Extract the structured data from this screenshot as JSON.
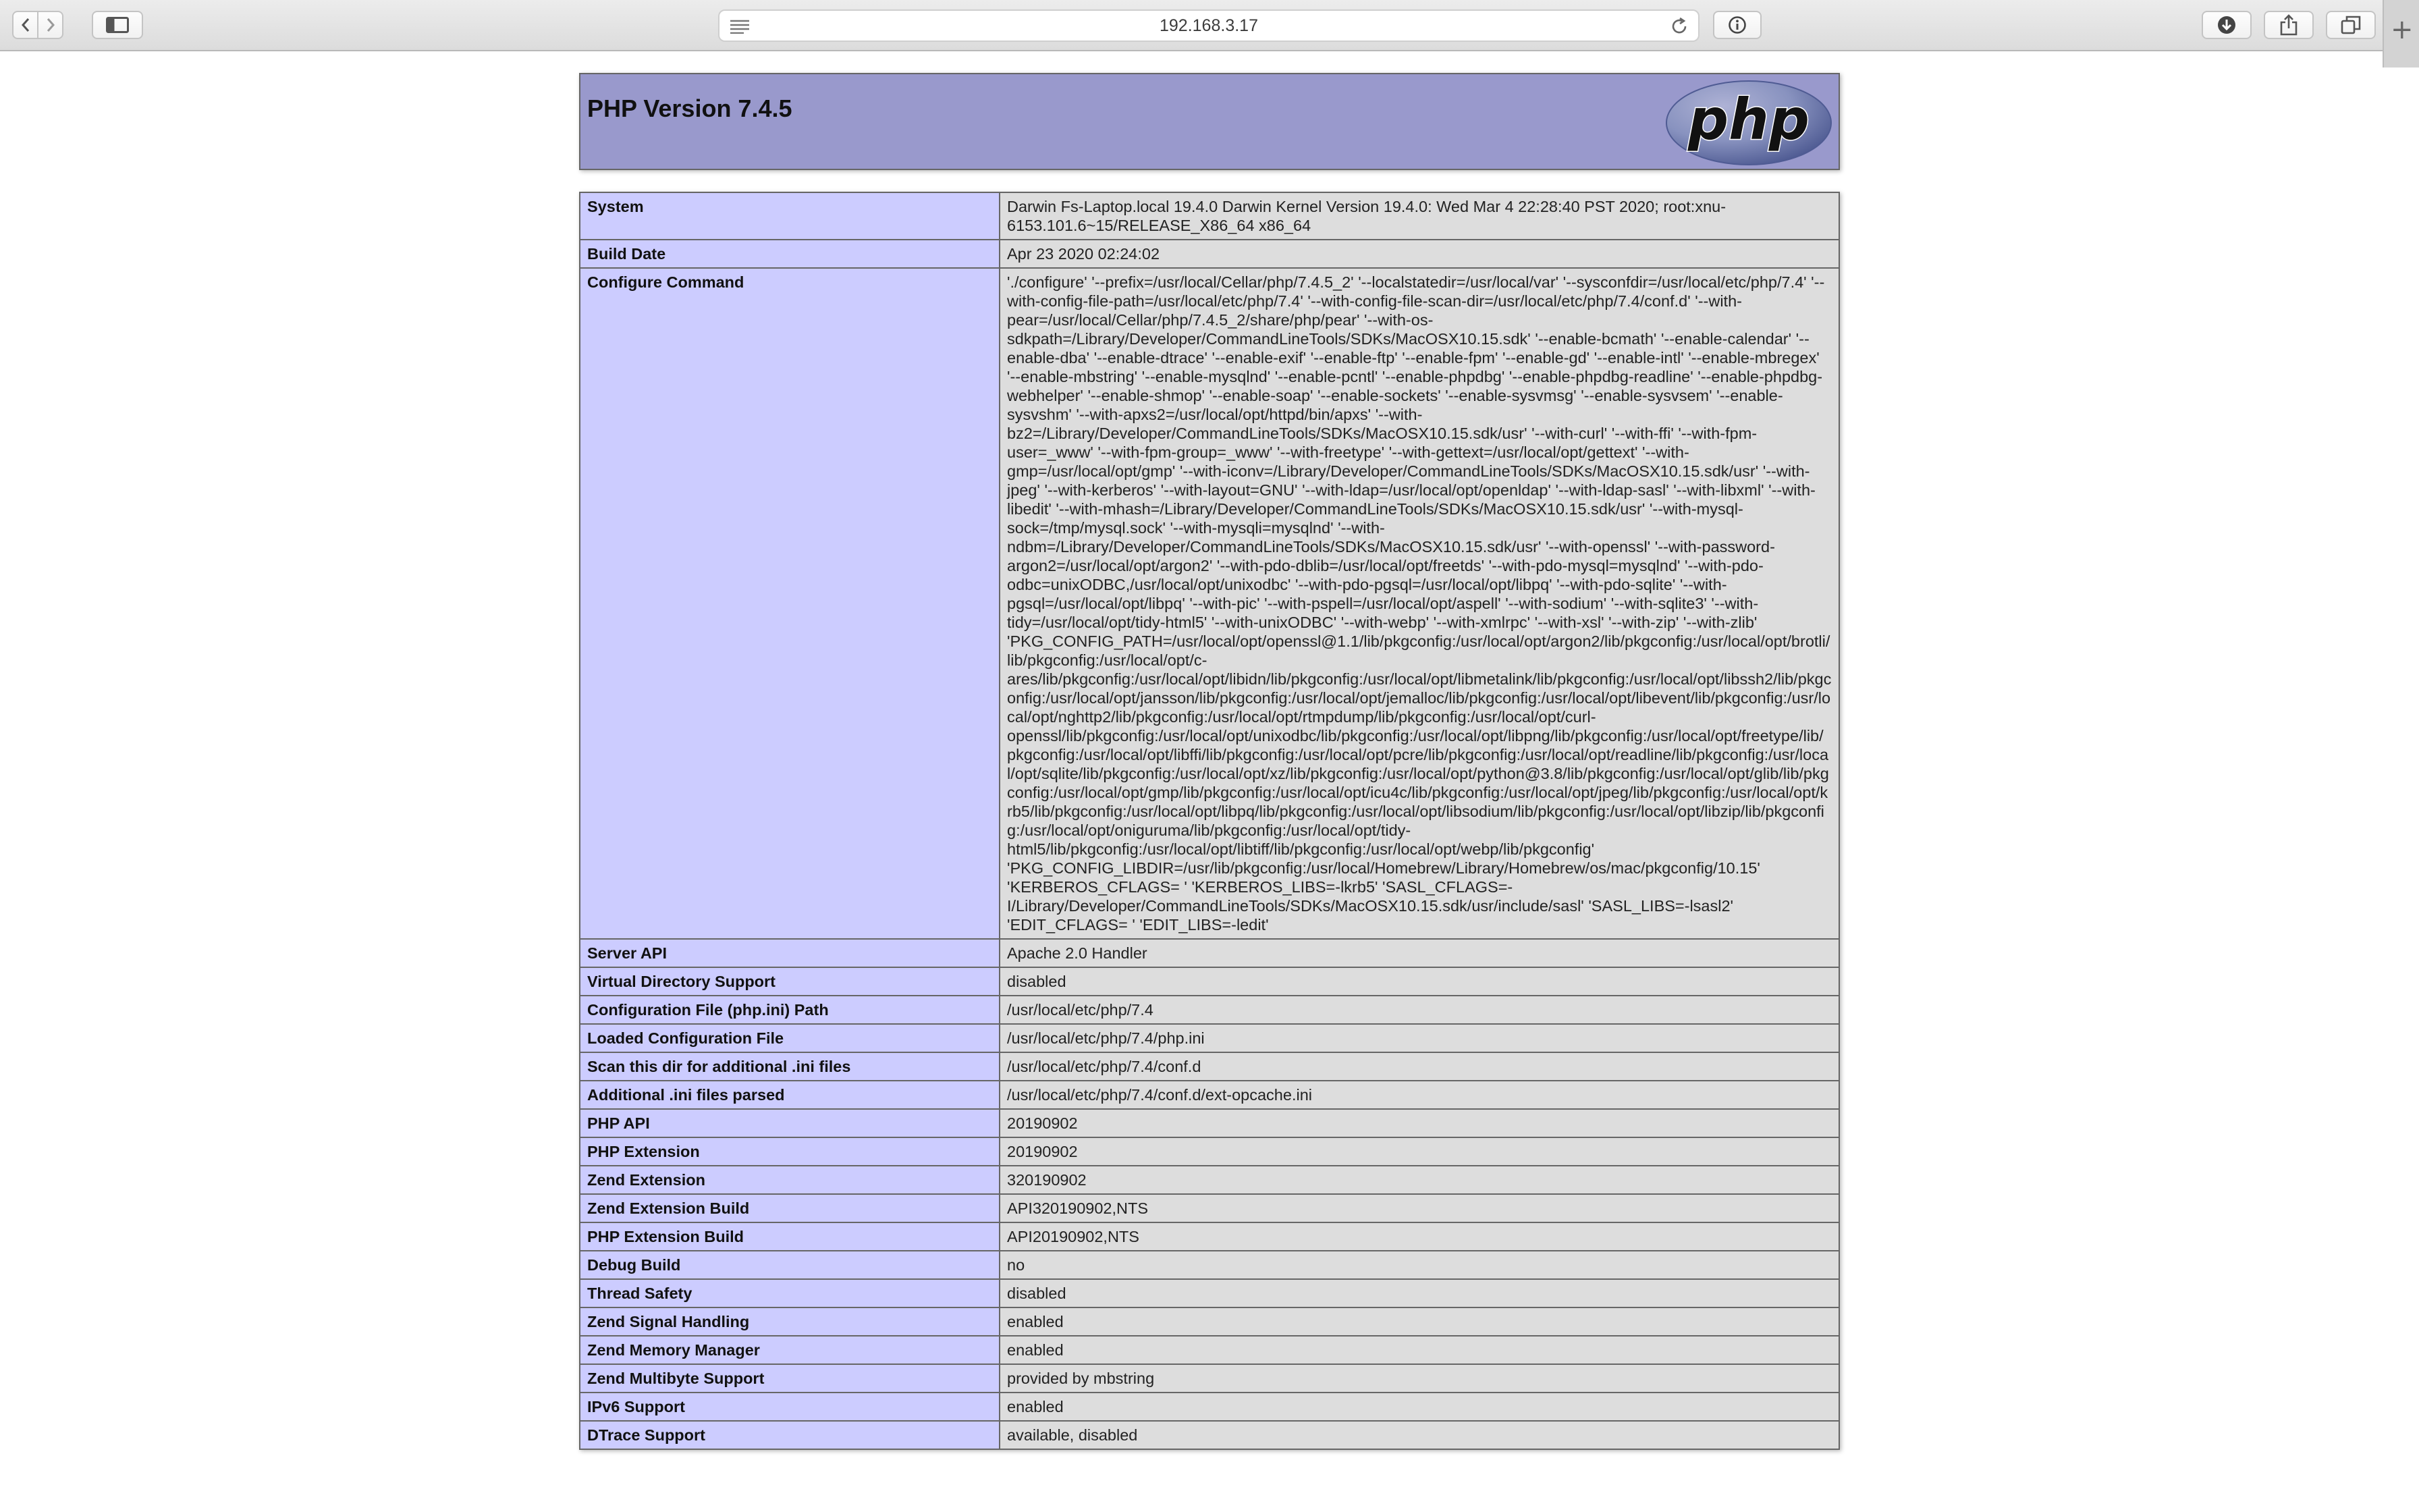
{
  "browser": {
    "url": "192.168.3.17",
    "new_tab_symbol": "+"
  },
  "icons": {
    "back": "chevron-left-icon",
    "forward": "chevron-right-icon",
    "sidebar": "sidebar-icon",
    "reader": "reader-icon",
    "reload": "reload-icon",
    "info": "info-icon",
    "downloads": "download-icon",
    "share": "share-icon",
    "tabs": "tab-overview-icon"
  },
  "colors": {
    "header_bg": "#9999cc",
    "key_cell_bg": "#ccccff",
    "value_cell_bg": "#dddddd",
    "logo_fill": "#8892bf"
  },
  "phpinfo": {
    "title": "PHP Version 7.4.5",
    "logo_text": "php",
    "rows": [
      {
        "key": "System",
        "value": "Darwin Fs-Laptop.local 19.4.0 Darwin Kernel Version 19.4.0: Wed Mar 4 22:28:40 PST 2020; root:xnu-6153.101.6~15/RELEASE_X86_64 x86_64"
      },
      {
        "key": "Build Date",
        "value": "Apr 23 2020 02:24:02"
      },
      {
        "key": "Configure Command",
        "value": "'./configure' '--prefix=/usr/local/Cellar/php/7.4.5_2' '--localstatedir=/usr/local/var' '--sysconfdir=/usr/local/etc/php/7.4' '--with-config-file-path=/usr/local/etc/php/7.4' '--with-config-file-scan-dir=/usr/local/etc/php/7.4/conf.d' '--with-pear=/usr/local/Cellar/php/7.4.5_2/share/php/pear' '--with-os-sdkpath=/Library/Developer/CommandLineTools/SDKs/MacOSX10.15.sdk' '--enable-bcmath' '--enable-calendar' '--enable-dba' '--enable-dtrace' '--enable-exif' '--enable-ftp' '--enable-fpm' '--enable-gd' '--enable-intl' '--enable-mbregex' '--enable-mbstring' '--enable-mysqlnd' '--enable-pcntl' '--enable-phpdbg' '--enable-phpdbg-readline' '--enable-phpdbg-webhelper' '--enable-shmop' '--enable-soap' '--enable-sockets' '--enable-sysvmsg' '--enable-sysvsem' '--enable-sysvshm' '--with-apxs2=/usr/local/opt/httpd/bin/apxs' '--with-bz2=/Library/Developer/CommandLineTools/SDKs/MacOSX10.15.sdk/usr' '--with-curl' '--with-ffi' '--with-fpm-user=_www' '--with-fpm-group=_www' '--with-freetype' '--with-gettext=/usr/local/opt/gettext' '--with-gmp=/usr/local/opt/gmp' '--with-iconv=/Library/Developer/CommandLineTools/SDKs/MacOSX10.15.sdk/usr' '--with-jpeg' '--with-kerberos' '--with-layout=GNU' '--with-ldap=/usr/local/opt/openldap' '--with-ldap-sasl' '--with-libxml' '--with-libedit' '--with-mhash=/Library/Developer/CommandLineTools/SDKs/MacOSX10.15.sdk/usr' '--with-mysql-sock=/tmp/mysql.sock' '--with-mysqli=mysqlnd' '--with-ndbm=/Library/Developer/CommandLineTools/SDKs/MacOSX10.15.sdk/usr' '--with-openssl' '--with-password-argon2=/usr/local/opt/argon2' '--with-pdo-dblib=/usr/local/opt/freetds' '--with-pdo-mysql=mysqlnd' '--with-pdo-odbc=unixODBC,/usr/local/opt/unixodbc' '--with-pdo-pgsql=/usr/local/opt/libpq' '--with-pdo-sqlite' '--with-pgsql=/usr/local/opt/libpq' '--with-pic' '--with-pspell=/usr/local/opt/aspell' '--with-sodium' '--with-sqlite3' '--with-tidy=/usr/local/opt/tidy-html5' '--with-unixODBC' '--with-webp' '--with-xmlrpc' '--with-xsl' '--with-zip' '--with-zlib' 'PKG_CONFIG_PATH=/usr/local/opt/openssl@1.1/lib/pkgconfig:/usr/local/opt/argon2/lib/pkgconfig:/usr/local/opt/brotli/lib/pkgconfig:/usr/local/opt/c-ares/lib/pkgconfig:/usr/local/opt/libidn/lib/pkgconfig:/usr/local/opt/libmetalink/lib/pkgconfig:/usr/local/opt/libssh2/lib/pkgconfig:/usr/local/opt/jansson/lib/pkgconfig:/usr/local/opt/jemalloc/lib/pkgconfig:/usr/local/opt/libevent/lib/pkgconfig:/usr/local/opt/nghttp2/lib/pkgconfig:/usr/local/opt/rtmpdump/lib/pkgconfig:/usr/local/opt/curl-openssl/lib/pkgconfig:/usr/local/opt/unixodbc/lib/pkgconfig:/usr/local/opt/libpng/lib/pkgconfig:/usr/local/opt/freetype/lib/pkgconfig:/usr/local/opt/libffi/lib/pkgconfig:/usr/local/opt/pcre/lib/pkgconfig:/usr/local/opt/readline/lib/pkgconfig:/usr/local/opt/sqlite/lib/pkgconfig:/usr/local/opt/xz/lib/pkgconfig:/usr/local/opt/python@3.8/lib/pkgconfig:/usr/local/opt/glib/lib/pkgconfig:/usr/local/opt/gmp/lib/pkgconfig:/usr/local/opt/icu4c/lib/pkgconfig:/usr/local/opt/jpeg/lib/pkgconfig:/usr/local/opt/krb5/lib/pkgconfig:/usr/local/opt/libpq/lib/pkgconfig:/usr/local/opt/libsodium/lib/pkgconfig:/usr/local/opt/libzip/lib/pkgconfig:/usr/local/opt/oniguruma/lib/pkgconfig:/usr/local/opt/tidy-html5/lib/pkgconfig:/usr/local/opt/libtiff/lib/pkgconfig:/usr/local/opt/webp/lib/pkgconfig' 'PKG_CONFIG_LIBDIR=/usr/lib/pkgconfig:/usr/local/Homebrew/Library/Homebrew/os/mac/pkgconfig/10.15' 'KERBEROS_CFLAGS= ' 'KERBEROS_LIBS=-lkrb5' 'SASL_CFLAGS=-I/Library/Developer/CommandLineTools/SDKs/MacOSX10.15.sdk/usr/include/sasl' 'SASL_LIBS=-lsasl2' 'EDIT_CFLAGS= ' 'EDIT_LIBS=-ledit'"
      },
      {
        "key": "Server API",
        "value": "Apache 2.0 Handler"
      },
      {
        "key": "Virtual Directory Support",
        "value": "disabled"
      },
      {
        "key": "Configuration File (php.ini) Path",
        "value": "/usr/local/etc/php/7.4"
      },
      {
        "key": "Loaded Configuration File",
        "value": "/usr/local/etc/php/7.4/php.ini"
      },
      {
        "key": "Scan this dir for additional .ini files",
        "value": "/usr/local/etc/php/7.4/conf.d"
      },
      {
        "key": "Additional .ini files parsed",
        "value": "/usr/local/etc/php/7.4/conf.d/ext-opcache.ini"
      },
      {
        "key": "PHP API",
        "value": "20190902"
      },
      {
        "key": "PHP Extension",
        "value": "20190902"
      },
      {
        "key": "Zend Extension",
        "value": "320190902"
      },
      {
        "key": "Zend Extension Build",
        "value": "API320190902,NTS"
      },
      {
        "key": "PHP Extension Build",
        "value": "API20190902,NTS"
      },
      {
        "key": "Debug Build",
        "value": "no"
      },
      {
        "key": "Thread Safety",
        "value": "disabled"
      },
      {
        "key": "Zend Signal Handling",
        "value": "enabled"
      },
      {
        "key": "Zend Memory Manager",
        "value": "enabled"
      },
      {
        "key": "Zend Multibyte Support",
        "value": "provided by mbstring"
      },
      {
        "key": "IPv6 Support",
        "value": "enabled"
      },
      {
        "key": "DTrace Support",
        "value": "available, disabled"
      }
    ]
  }
}
